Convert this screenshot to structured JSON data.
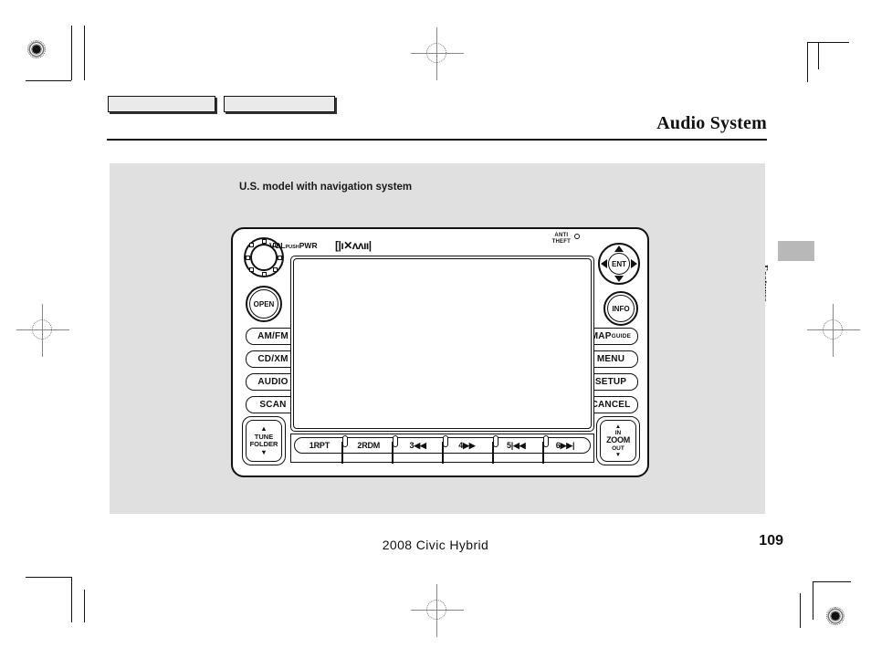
{
  "page": {
    "title": "Audio System",
    "side_tab_label": "Features",
    "footer_model": "2008  Civic  Hybrid",
    "page_number": "109",
    "colors": {
      "panel_bg": "#e0e0e0",
      "ink": "#111111",
      "tab_block": "#b8b8b8",
      "page_bg": "#ffffff"
    }
  },
  "figure": {
    "caption": "U.S. model with navigation system",
    "head_unit": {
      "volume_knob": {
        "label_main": "VOL",
        "label_sub": "PUSH",
        "label_pwr": "PWR",
        "icon": "rotary-knob-icon"
      },
      "xm_logo": "[|ı✕ʌʌıı|",
      "anti_theft": {
        "line1": "ANTI",
        "line2": "THEFT",
        "led": "indicator-led"
      },
      "open_button": "OPEN",
      "ent_pad": {
        "center": "ENT",
        "directions": [
          "up",
          "down",
          "left",
          "right"
        ]
      },
      "info_button": "INFO",
      "left_buttons": [
        {
          "label": "AM/FM",
          "name": "am-fm-button"
        },
        {
          "label": "CD/XM",
          "name": "cd-xm-button"
        },
        {
          "label": "AUDIO",
          "name": "audio-button"
        },
        {
          "label": "SCAN",
          "name": "scan-button"
        }
      ],
      "right_buttons": [
        {
          "label_big": "MAP",
          "label_small": "GUIDE",
          "name": "map-guide-button"
        },
        {
          "label_big": "MENU",
          "label_small": "",
          "name": "menu-button"
        },
        {
          "label_big": "SETUP",
          "label_small": "",
          "name": "setup-button"
        },
        {
          "label_big": "CANCEL",
          "label_small": "",
          "name": "cancel-button"
        }
      ],
      "tune_folder": {
        "line1": "TUNE",
        "line2": "FOLDER",
        "up": "▲",
        "down": "▼"
      },
      "zoom_button": {
        "in": "IN",
        "mid": "ZOOM",
        "out": "OUT",
        "up": "▲",
        "down": "▼"
      },
      "presets": [
        {
          "label": "1RPT"
        },
        {
          "label": "2RDM"
        },
        {
          "label": "3◀◀"
        },
        {
          "label": "4▶▶"
        },
        {
          "label": "5|◀◀"
        },
        {
          "label": "6▶▶|"
        }
      ]
    }
  }
}
